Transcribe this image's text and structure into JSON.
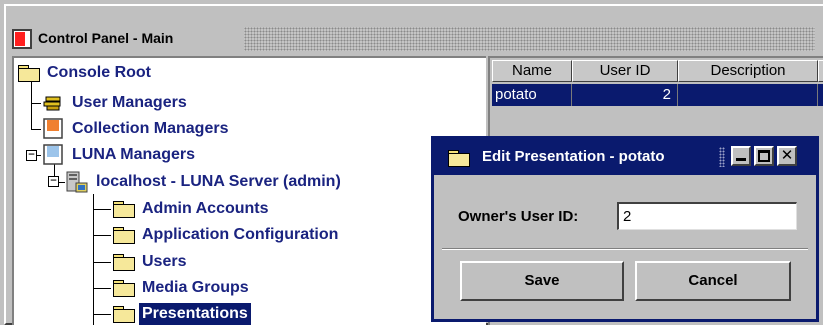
{
  "window": {
    "title": "Control Panel - Main"
  },
  "tree": {
    "root": "Console Root",
    "user_managers": "User Managers",
    "collection_managers": "Collection Managers",
    "luna_managers": "LUNA Managers",
    "server": "localhost - LUNA Server (admin)",
    "admin_accounts": "Admin Accounts",
    "application_configuration": "Application Configuration",
    "users": "Users",
    "media_groups": "Media Groups",
    "presentations": "Presentations",
    "expander_minus": "−"
  },
  "table": {
    "headers": [
      "Name",
      "User ID",
      "Description"
    ],
    "rows": [
      {
        "name": "potato",
        "user_id": "2",
        "description": ""
      }
    ]
  },
  "dialog": {
    "title": "Edit Presentation - potato",
    "owner_label": "Owner's User ID:",
    "owner_value": "2",
    "save_label": "Save",
    "cancel_label": "Cancel",
    "close_glyph": "✕"
  },
  "colors": {
    "selection": "#0a1a6e",
    "tree_text": "#1a2380",
    "face": "#c0c0c0"
  }
}
